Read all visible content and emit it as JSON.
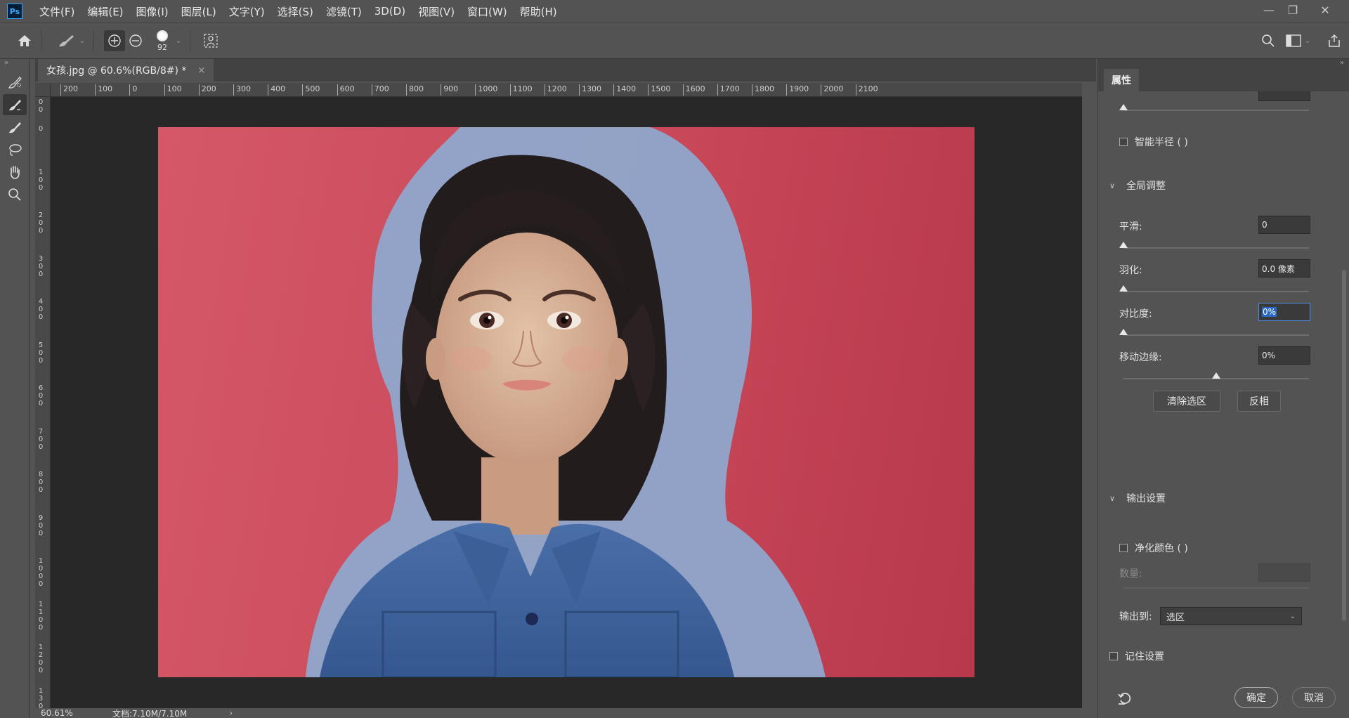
{
  "app": {
    "logo": "Ps",
    "menu": [
      "文件(F)",
      "编辑(E)",
      "图像(I)",
      "图层(L)",
      "文字(Y)",
      "选择(S)",
      "滤镜(T)",
      "3D(D)",
      "视图(V)",
      "窗口(W)",
      "帮助(H)"
    ]
  },
  "window_controls": {
    "minimize": "—",
    "restore": "❐",
    "close": "✕"
  },
  "options_bar": {
    "brush_size": "92"
  },
  "document": {
    "tab_title": "女孩.jpg @ 60.6%(RGB/8#) *",
    "close_glyph": "×"
  },
  "ruler_top": [
    "200",
    "100",
    "0",
    "100",
    "200",
    "300",
    "400",
    "500",
    "600",
    "700",
    "800",
    "900",
    "1000",
    "1100",
    "1200",
    "1300",
    "1400",
    "1500",
    "1600",
    "1700",
    "1800",
    "1900",
    "2000",
    "2100"
  ],
  "ruler_left": [
    "00",
    "0",
    "100",
    "200",
    "300",
    "400",
    "500",
    "600",
    "700",
    "800",
    "900",
    "1000",
    "1100",
    "1200",
    "1300"
  ],
  "status": {
    "zoom": "60.61%",
    "doc_info": "文档:7.10M/7.10M",
    "arrow": "›"
  },
  "panel": {
    "tab": "属性",
    "smart_radius_label": "智能半径 ( )",
    "global_adjust_title": "全局调整",
    "smooth_label": "平滑:",
    "smooth_value": "0",
    "smooth_level": 0,
    "feather_label": "羽化:",
    "feather_value": "0.0 像素",
    "feather_level": 0,
    "contrast_label": "对比度:",
    "contrast_value": "0%",
    "contrast_level": 0,
    "shift_edge_label": "移动边缘:",
    "shift_edge_value": "0%",
    "shift_edge_level": 0.5,
    "clear_selection_button": "清除选区",
    "invert_button": "反相",
    "output_title": "输出设置",
    "decontaminate_label": "净化颜色 ( )",
    "amount_label": "数量:",
    "output_to_label": "输出到:",
    "output_to_value": "选区",
    "remember_label": "记住设置",
    "ok_button": "确定",
    "cancel_button": "取消"
  },
  "colors": {
    "background": "#c9495a",
    "overlay": "#8fa8cc",
    "accent": "#2a68c8"
  }
}
